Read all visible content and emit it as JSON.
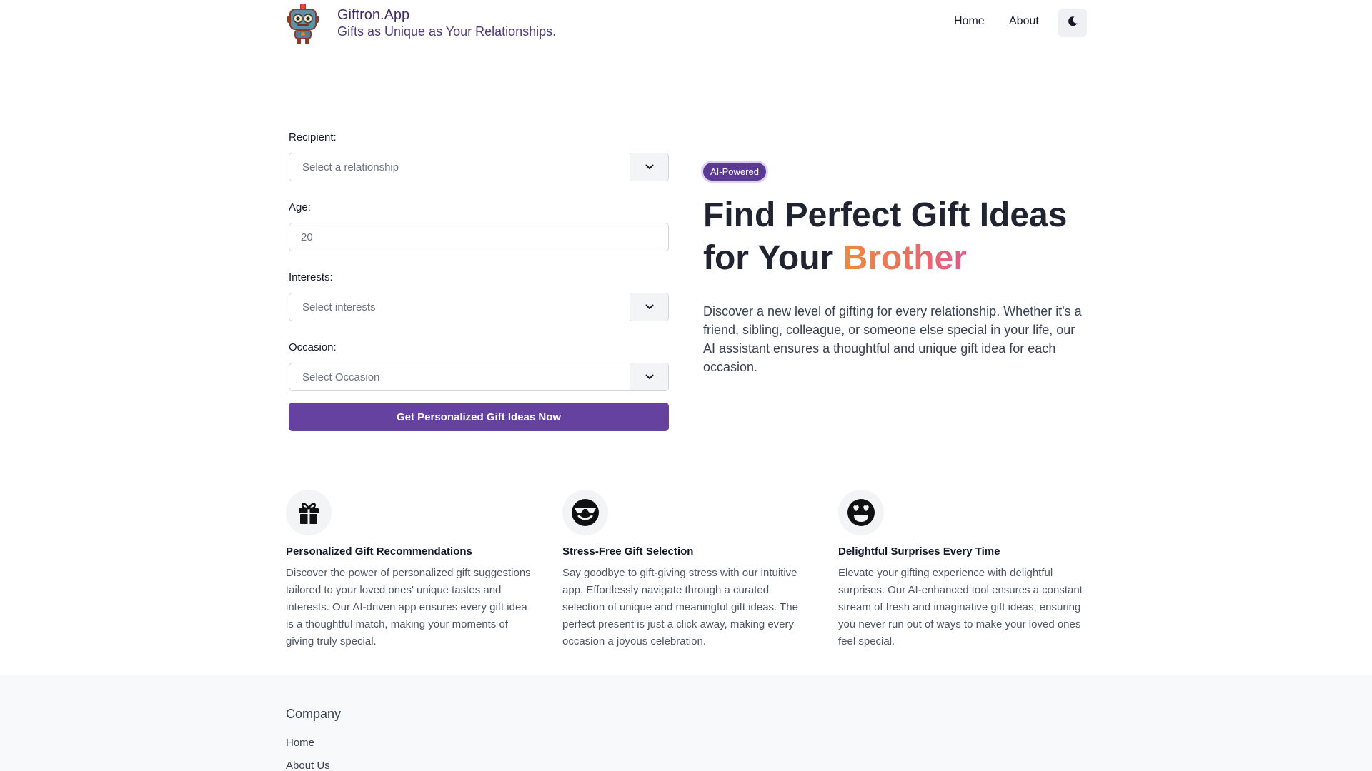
{
  "header": {
    "brand_name": "Giftron.App",
    "brand_tagline": "Gifts as Unique as Your Relationships.",
    "nav": [
      {
        "label": "Home"
      },
      {
        "label": "About"
      }
    ],
    "theme_toggle_icon": "moon-icon"
  },
  "form": {
    "recipient": {
      "label": "Recipient:",
      "placeholder": "Select a relationship"
    },
    "age": {
      "label": "Age:",
      "placeholder": "20"
    },
    "interests": {
      "label": "Interests:",
      "placeholder": "Select interests"
    },
    "occasion": {
      "label": "Occasion:",
      "placeholder": "Select Occasion"
    },
    "submit_label": "Get Personalized Gift Ideas Now"
  },
  "hero": {
    "badge": "AI-Powered",
    "title_line1": "Find Perfect Gift Ideas",
    "title_line2_prefix": "for Your ",
    "title_accent": "Brother",
    "description": "Discover a new level of gifting for every relationship. Whether it's a friend, sibling, colleague, or someone else special in your life, our AI assistant ensures a thoughtful and unique gift idea for each occasion."
  },
  "features": [
    {
      "icon": "gift-icon",
      "title": "Personalized Gift Recommendations",
      "description": "Discover the power of personalized gift suggestions tailored to your loved ones' unique tastes and interests. Our AI-driven app ensures every gift idea is a thoughtful match, making your moments of giving truly special."
    },
    {
      "icon": "smiling-face-with-sunglasses-icon",
      "title": "Stress-Free Gift Selection",
      "description": "Say goodbye to gift-giving stress with our intuitive app. Effortlessly navigate through a curated selection of unique and meaningful gift ideas. The perfect present is just a click away, making every occasion a joyous celebration."
    },
    {
      "icon": "heart-eyes-face-icon",
      "title": "Delightful Surprises Every Time",
      "description": "Elevate your gifting experience with delightful surprises. Our AI-enhanced tool ensures a constant stream of fresh and imaginative gift ideas, ensuring you never run out of ways to make your loved ones feel special."
    }
  ],
  "footer": {
    "heading": "Company",
    "links": [
      {
        "label": "Home"
      },
      {
        "label": "About Us"
      }
    ]
  },
  "colors": {
    "primary": "#6541a0",
    "brand_text": "#3b2a6e",
    "accent_gradient_start": "#f08a3a",
    "accent_gradient_end": "#e05a8a"
  }
}
